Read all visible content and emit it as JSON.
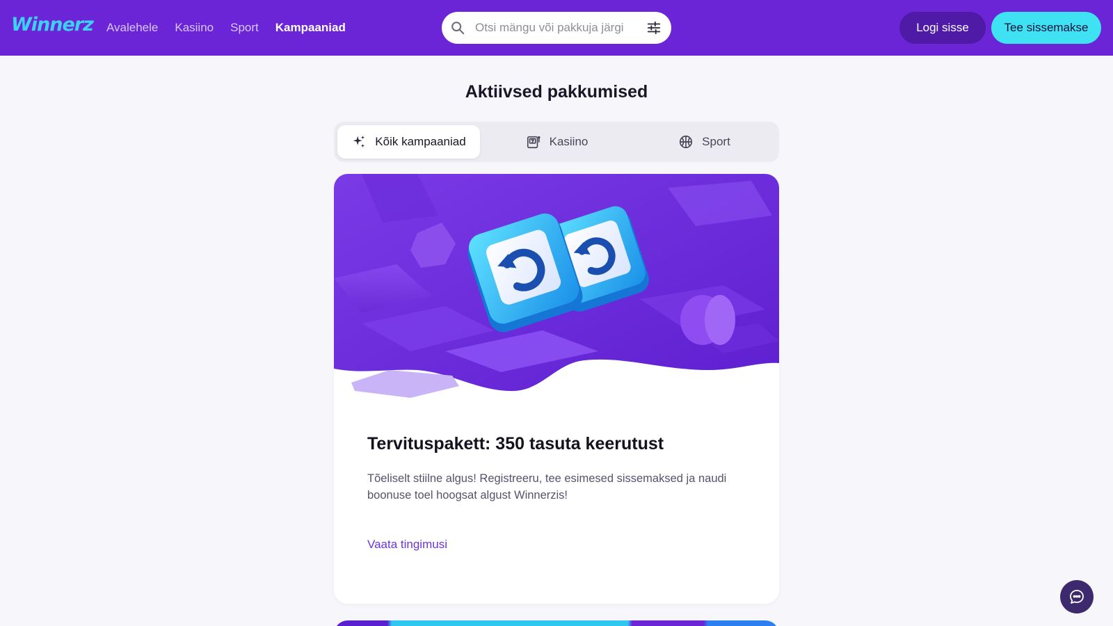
{
  "header": {
    "logo": "Winnerz",
    "nav": [
      {
        "label": "Avalehele"
      },
      {
        "label": "Kasiino"
      },
      {
        "label": "Sport"
      },
      {
        "label": "Kampaaniad",
        "active": true
      }
    ],
    "search": {
      "placeholder": "Otsi mängu või pakkuja järgi",
      "value": ""
    },
    "login_label": "Logi sisse",
    "deposit_label": "Tee sissemakse"
  },
  "page": {
    "title": "Aktiivsed pakkumised"
  },
  "tabs": [
    {
      "label": "Kõik kampaaniad",
      "icon": "sparkles-icon",
      "active": true
    },
    {
      "label": "Kasiino",
      "icon": "slot-machine-icon",
      "active": false
    },
    {
      "label": "Sport",
      "icon": "basketball-icon",
      "active": false
    }
  ],
  "promo": {
    "title": "Tervituspakett: 350 tasuta keerutust",
    "description": "Tõeliselt stiilne algus! Registreeru, tee esimesed sissemaksed ja naudi boonuse toel hoogsat algust Winnerzis!",
    "terms_label": "Vaata tingimusi"
  },
  "colors": {
    "header_bg": "#6b24d6",
    "accent_cyan": "#3fe2f3",
    "login_bg": "#4f1aa6",
    "link": "#6b35d8",
    "page_bg": "#f7f7fb"
  }
}
